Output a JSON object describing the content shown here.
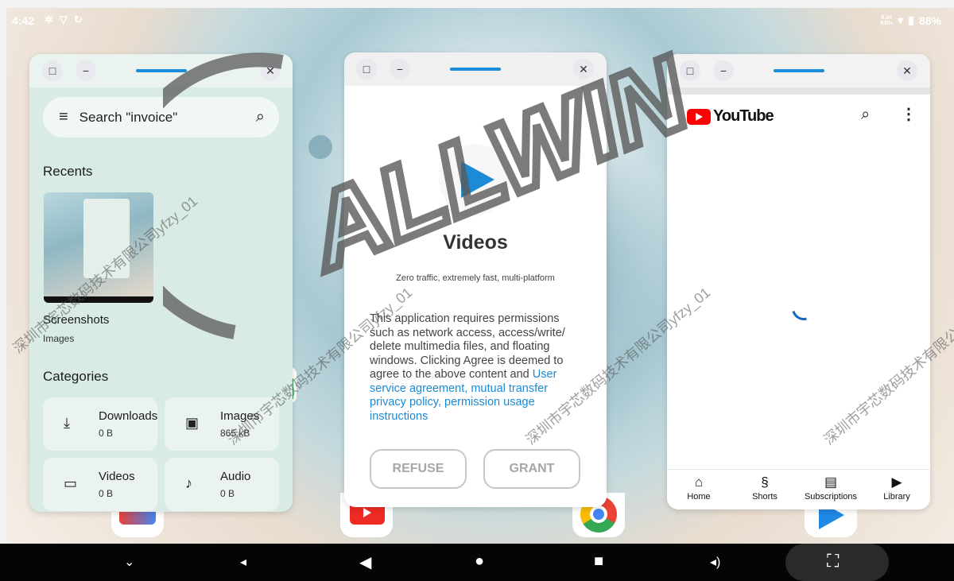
{
  "status_bar": {
    "time": "4:42",
    "net_speed_value": "6.04",
    "net_speed_unit": "KB/s",
    "battery": "88%",
    "left_icons": [
      "gear-icon",
      "shield-icon",
      "sync-icon"
    ]
  },
  "files_window": {
    "search_placeholder": "Search \"invoice\"",
    "recents_heading": "Recents",
    "recent_item": {
      "name": "Screenshots",
      "type": "Images"
    },
    "categories_heading": "Categories",
    "categories": [
      {
        "name": "Downloads",
        "size": "0 B",
        "icon": "download-icon"
      },
      {
        "name": "Images",
        "size": "865 kB",
        "icon": "image-icon"
      },
      {
        "name": "Videos",
        "size": "0 B",
        "icon": "video-icon"
      },
      {
        "name": "Audio",
        "size": "0 B",
        "icon": "music-note-icon"
      }
    ]
  },
  "videos_window": {
    "title": "Videos",
    "subtitle": "Zero traffic, extremely fast, multi-platform",
    "body_text": "This application requires permissions such as network access, access/write/ delete multimedia files, and floating windows. Clicking Agree is deemed to agree to the above content and ",
    "body_link": "User service agreement, mutual transfer privacy policy, permission usage instructions",
    "refuse_label": "REFUSE",
    "grant_label": "GRANT",
    "accent_color": "#1d8ad6"
  },
  "youtube_window": {
    "logo_text": "YouTube",
    "nav": [
      {
        "label": "Home",
        "icon": "home-icon"
      },
      {
        "label": "Shorts",
        "icon": "shorts-icon"
      },
      {
        "label": "Subscriptions",
        "icon": "subscriptions-icon"
      },
      {
        "label": "Library",
        "icon": "library-icon"
      }
    ]
  },
  "watermark": {
    "brand": "ALLWIN",
    "company": "深圳市宇芯数码技术有限公司yfzy_01"
  }
}
